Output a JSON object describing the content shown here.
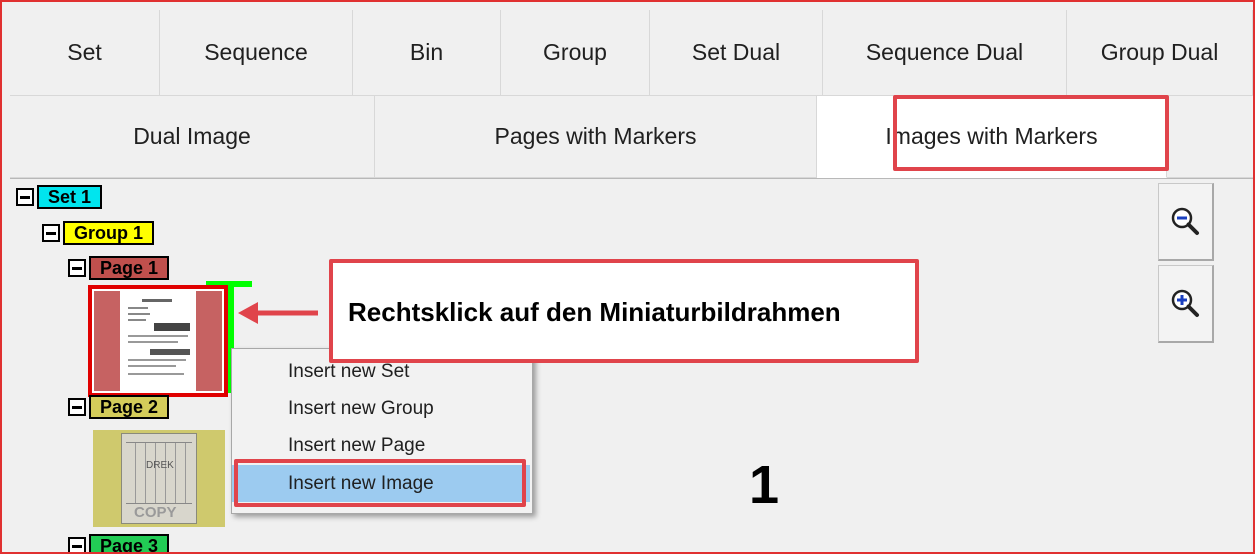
{
  "tabs_row1": [
    "Set",
    "Sequence",
    "Bin",
    "Group",
    "Set Dual",
    "Sequence Dual",
    "Group Dual"
  ],
  "tabs_row2": [
    "Dual Image",
    "Pages with Markers",
    "Images with Markers"
  ],
  "active_tab": "Images with Markers",
  "tree": {
    "set": "Set 1",
    "group": "Group 1",
    "page1": "Page 1",
    "page2": "Page 2",
    "page3": "Page 3",
    "thumb2_watermark": "COPY",
    "thumb2_label": "DREK"
  },
  "zoom": {
    "out_icon": "zoom-out-icon",
    "in_icon": "zoom-in-icon"
  },
  "context_menu": {
    "items": [
      "Insert new Set",
      "Insert new Group",
      "Insert new Page",
      "Insert new Image"
    ],
    "highlighted": "Insert new Image"
  },
  "annotation": {
    "callout": "Rechtsklick auf den Miniaturbildrahmen",
    "step": "1"
  },
  "colors": {
    "set_label": "#00e5ee",
    "group_label": "#ffff00",
    "page1_label": "#c0504d",
    "page2_label": "#d4cc5a",
    "page3_label": "#22cc55",
    "highlight_red": "#e0444b",
    "selection_green": "#00ff00",
    "menu_highlight": "#9ccbf0"
  }
}
